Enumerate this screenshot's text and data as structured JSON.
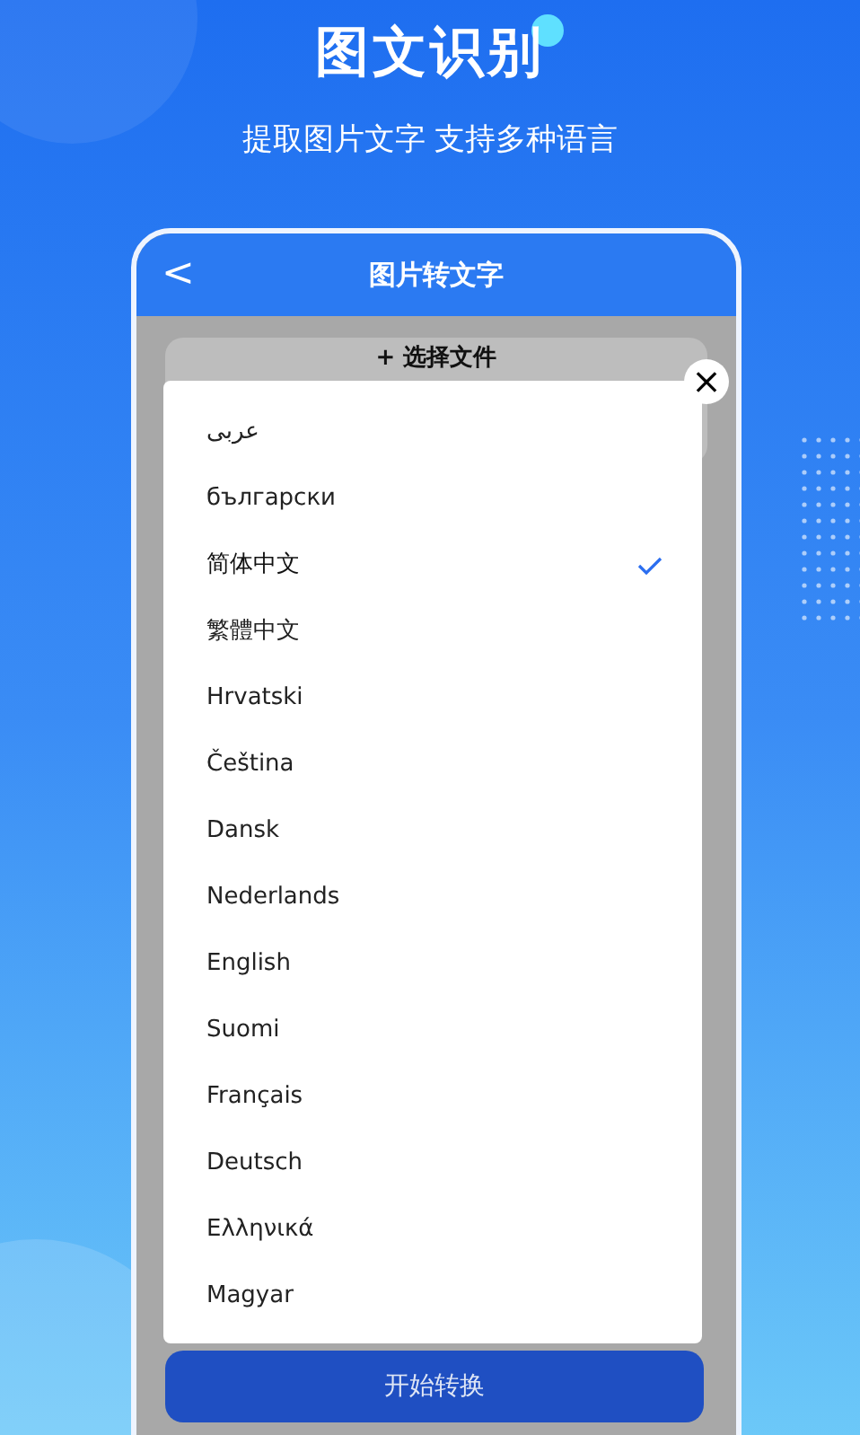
{
  "headline": "图文识别",
  "subtitle": "提取图片文字 支持多种语言",
  "screen": {
    "title": "图片转文字",
    "back": "<",
    "file_button": "+ 选择文件",
    "convert_button": "开始转换"
  },
  "language_menu": {
    "close": "×",
    "items": [
      {
        "label": "عربى",
        "selected": false
      },
      {
        "label": "български",
        "selected": false
      },
      {
        "label": "简体中文",
        "selected": true
      },
      {
        "label": "繁體中文",
        "selected": false
      },
      {
        "label": "Hrvatski",
        "selected": false
      },
      {
        "label": "Čeština",
        "selected": false
      },
      {
        "label": "Dansk",
        "selected": false
      },
      {
        "label": "Nederlands",
        "selected": false
      },
      {
        "label": "English",
        "selected": false
      },
      {
        "label": "Suomi",
        "selected": false
      },
      {
        "label": "Français",
        "selected": false
      },
      {
        "label": "Deutsch",
        "selected": false
      },
      {
        "label": "Ελληνικά",
        "selected": false
      },
      {
        "label": "Magyar",
        "selected": false
      }
    ]
  }
}
